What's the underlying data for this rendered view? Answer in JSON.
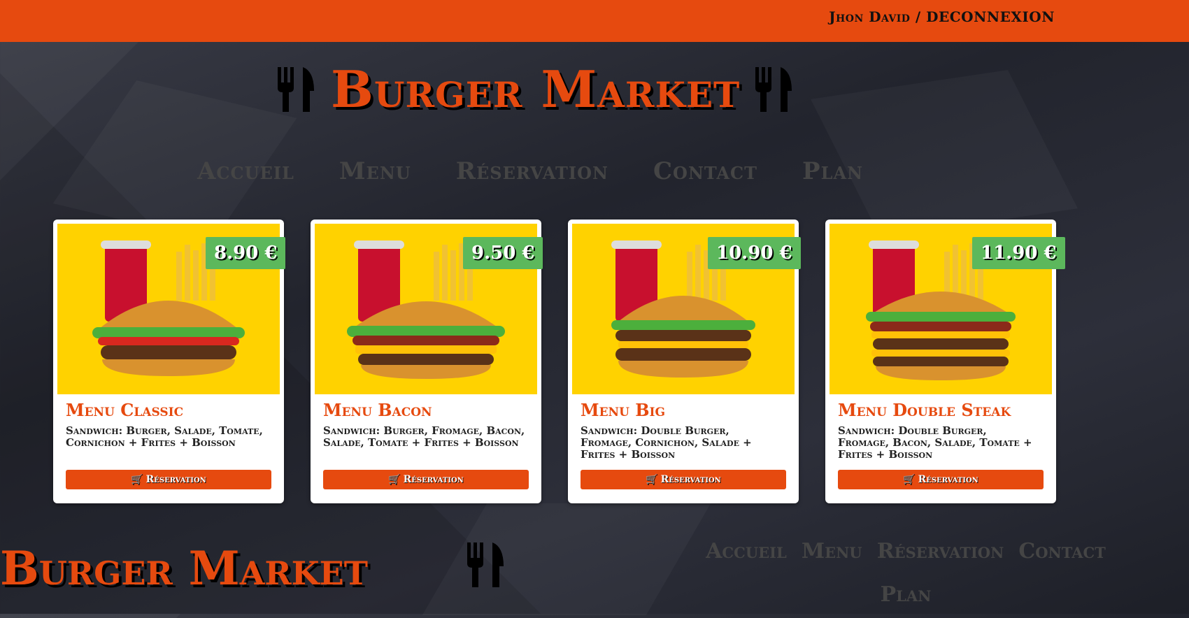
{
  "header": {
    "user_link": "Jhon David / DECONNEXION"
  },
  "brand": {
    "title": "Burger Market",
    "left_icon": "cutlery-icon",
    "right_icon": "cutlery-icon"
  },
  "nav": {
    "items": [
      "Accueil",
      "Menu",
      "Réservation",
      "Contact",
      "Plan"
    ]
  },
  "menus": [
    {
      "title": "Menu Classic",
      "price": "8.90 €",
      "description": "Sandwich: Burger, Salade, Tomate, Cornichon + Frites + Boisson",
      "button": "Réservation"
    },
    {
      "title": "Menu Bacon",
      "price": "9.50 €",
      "description": "Sandwich: Burger, Fromage, Bacon, Salade, Tomate + Frites + Boisson",
      "button": "Réservation"
    },
    {
      "title": "Menu Big",
      "price": "10.90 €",
      "description": "Sandwich: Double Burger, Fromage, Cornichon, Salade + Frites + Boisson",
      "button": "Réservation"
    },
    {
      "title": "Menu Double Steak",
      "price": "11.90 €",
      "description": "Sandwich: Double Burger, Fromage, Bacon, Salade, Tomate + Frites + Boisson",
      "button": "Réservation"
    }
  ],
  "footer": {
    "title": "Burger Market",
    "nav": [
      "Accueil",
      "Menu",
      "Réservation",
      "Contact",
      "Plan"
    ]
  },
  "colors": {
    "accent": "#e64a0f",
    "price_badge": "#5cb85c",
    "card_image_bg": "#ffd200",
    "nav_text": "#454545"
  },
  "icons": {
    "cart": "cart-icon",
    "cutlery": "cutlery-icon"
  }
}
